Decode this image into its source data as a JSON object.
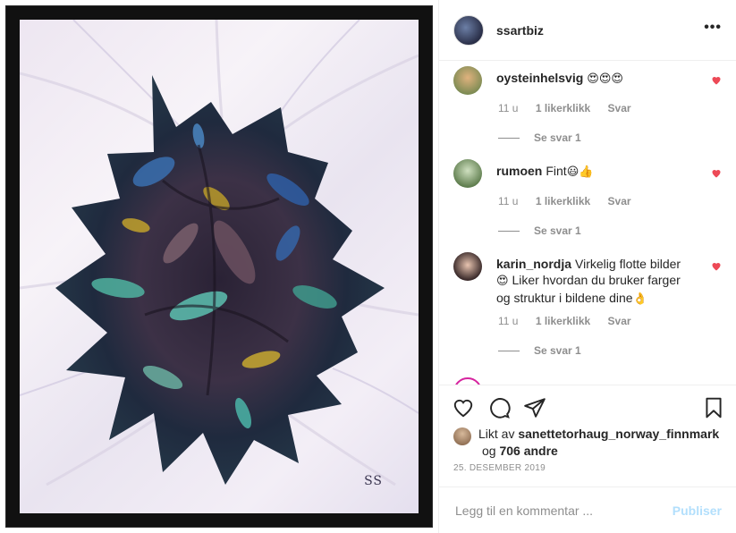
{
  "post": {
    "username": "ssartbiz",
    "more_label": "•••",
    "artwork_signature": "SS"
  },
  "comments": [
    {
      "username": "oysteinhelsvig",
      "text": "",
      "emojis": "😍😍😍",
      "time": "11 u",
      "likes": "1 likerklikk",
      "reply": "Svar",
      "view_replies": "Se svar 1",
      "liked": true
    },
    {
      "username": "rumoen",
      "text": "Fint",
      "emojis": "😃👍",
      "time": "11 u",
      "likes": "1 likerklikk",
      "reply": "Svar",
      "view_replies": "Se svar 1",
      "liked": true
    },
    {
      "username": "karin_nordja",
      "text": "Virkelig flotte bilder",
      "emojis_mid": "😍",
      "text2": "Liker hvordan du bruker farger og struktur i bildene dine",
      "emojis_end": "👌",
      "time": "11 u",
      "likes": "1 likerklikk",
      "reply": "Svar",
      "view_replies": "Se svar 1",
      "liked": true
    }
  ],
  "likes": {
    "prefix": "Likt av",
    "user": "sanettetorhaug_norway_finnmark",
    "and": "og",
    "others": "706 andre"
  },
  "date": "25. DESEMBER 2019",
  "add_comment": {
    "placeholder": "Legg til en kommentar ...",
    "publish_label": "Publiser"
  },
  "colors": {
    "heart": "#ed4956",
    "publish_disabled": "#b2dffc",
    "meta": "#8e8e8e"
  },
  "icons": [
    "more-icon",
    "heart-icon",
    "comment-icon",
    "share-icon",
    "bookmark-icon"
  ]
}
